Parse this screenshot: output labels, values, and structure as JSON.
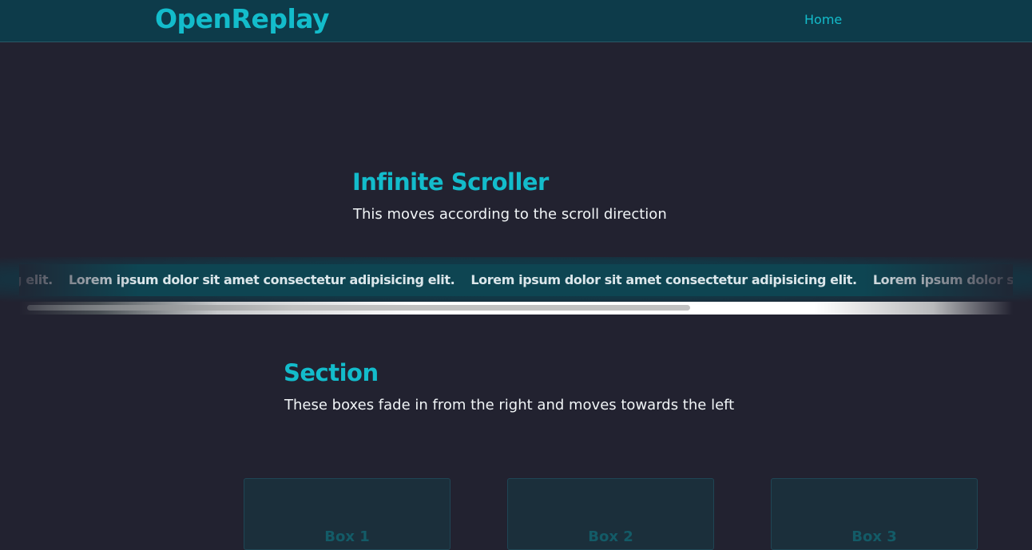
{
  "navbar": {
    "logo": "OpenReplay",
    "links": [
      {
        "label": "Home"
      }
    ]
  },
  "hero": {
    "title": "Infinite Scroller",
    "subtitle": "This moves according to the scroll direction"
  },
  "scroller": {
    "items": [
      "adipisicing elit.",
      "Lorem ipsum dolor sit amet consectetur adipisicing elit.",
      "Lorem ipsum dolor sit amet consectetur adipisicing elit.",
      "Lorem ipsum dolor sit amet consectetur adipisicing elit."
    ]
  },
  "section": {
    "title": "Section",
    "subtitle": "These boxes fade in from the right and moves towards the left"
  },
  "boxes": [
    {
      "label": "Box 1"
    },
    {
      "label": "Box 2"
    },
    {
      "label": "Box 3"
    }
  ],
  "colors": {
    "accent": "#13bccb",
    "navbar_bg": "#0d3b4a",
    "page_bg": "#222230"
  }
}
